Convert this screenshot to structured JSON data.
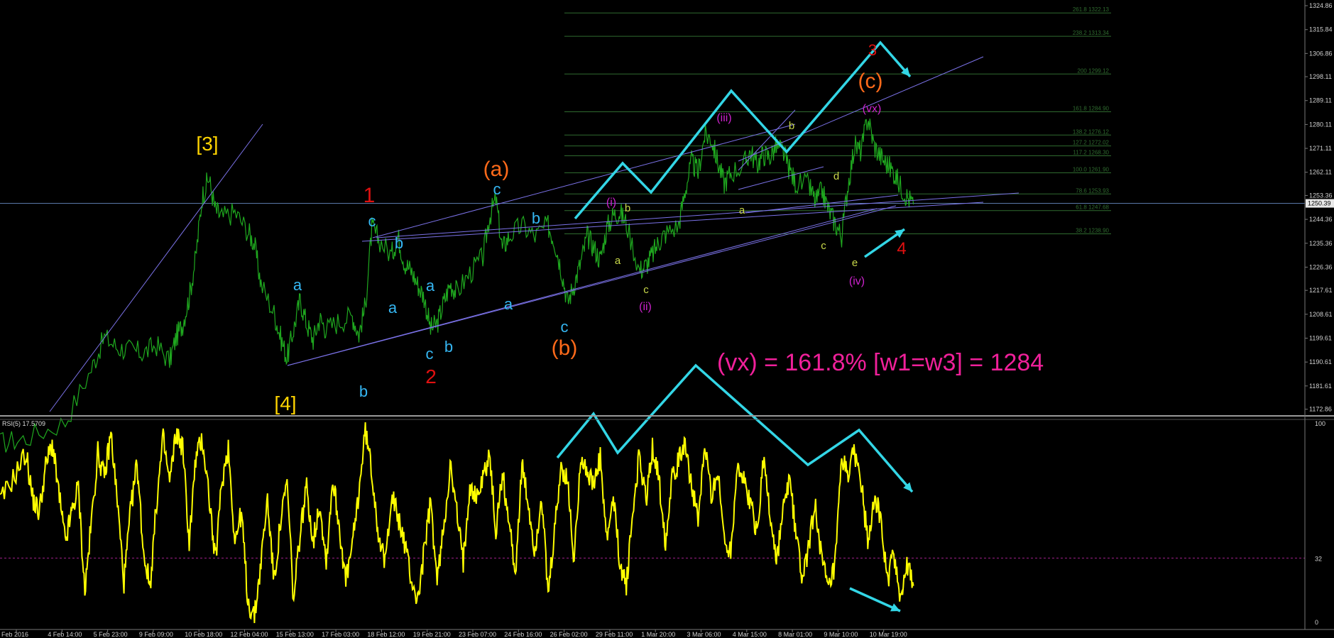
{
  "chart_data": {
    "type": "line",
    "price_axis": {
      "ticks": [
        "1324.86",
        "1315.84",
        "1306.86",
        "1298.11",
        "1289.11",
        "1280.11",
        "1271.11",
        "1262.11",
        "1253.36",
        "1244.36",
        "1235.36",
        "1226.36",
        "1217.61",
        "1208.61",
        "1199.61",
        "1190.61",
        "1181.61",
        "1172.86"
      ],
      "current_label": "1250.39",
      "current_price": 1250.39,
      "range": [
        1170.6,
        1327.0
      ]
    },
    "rsi": {
      "label": "RSI(5) 17.5709",
      "ticks": [
        "100",
        "32",
        "0"
      ],
      "level": 32,
      "range": [
        0,
        100
      ]
    },
    "time_axis": {
      "ticks": [
        "Feb 2016",
        "4 Feb 14:00",
        "5 Feb 23:00",
        "9 Feb 09:00",
        "10 Feb 18:00",
        "12 Feb 04:00",
        "15 Feb 13:00",
        "17 Feb 03:00",
        "18 Feb 12:00",
        "19 Feb 21:00",
        "23 Feb 07:00",
        "24 Feb 16:00",
        "26 Feb 02:00",
        "29 Feb 11:00",
        "1 Mar 20:00",
        "3 Mar 06:00",
        "4 Mar 15:00",
        "8 Mar 01:00",
        "9 Mar 10:00",
        "10 Mar 19:00"
      ]
    },
    "fib_levels": [
      {
        "label": "261.8  1322.13",
        "price": 1322.13
      },
      {
        "label": "238.2  1313.34",
        "price": 1313.34
      },
      {
        "label": "200  1299.12",
        "price": 1299.12
      },
      {
        "label": "161.8  1284.90",
        "price": 1284.9
      },
      {
        "label": "138.2  1276.12",
        "price": 1276.12
      },
      {
        "label": "127.2  1272.02",
        "price": 1272.02
      },
      {
        "label": "117.2  1268.30",
        "price": 1268.3
      },
      {
        "label": "100.0    1261.90",
        "price": 1261.9
      },
      {
        "label": "78.6  1253.93",
        "price": 1253.93
      },
      {
        "label": "61.8  1247.68",
        "price": 1247.68
      },
      {
        "label": "38.2  1238.90",
        "price": 1238.9
      }
    ],
    "price_series": [
      [
        0.0,
        1160
      ],
      [
        0.02,
        1162
      ],
      [
        0.05,
        1168
      ],
      [
        0.07,
        1188
      ],
      [
        0.08,
        1200
      ],
      [
        0.09,
        1196
      ],
      [
        0.1,
        1195
      ],
      [
        0.11,
        1194
      ],
      [
        0.12,
        1197
      ],
      [
        0.13,
        1191
      ],
      [
        0.135,
        1200
      ],
      [
        0.14,
        1205
      ],
      [
        0.145,
        1215
      ],
      [
        0.15,
        1230
      ],
      [
        0.155,
        1253
      ],
      [
        0.16,
        1260
      ],
      [
        0.165,
        1248
      ],
      [
        0.17,
        1245
      ],
      [
        0.18,
        1247
      ],
      [
        0.19,
        1240
      ],
      [
        0.195,
        1235
      ],
      [
        0.2,
        1220
      ],
      [
        0.21,
        1209
      ],
      [
        0.215,
        1200
      ],
      [
        0.22,
        1192
      ],
      [
        0.225,
        1203
      ],
      [
        0.23,
        1214
      ],
      [
        0.235,
        1205
      ],
      [
        0.24,
        1199
      ],
      [
        0.245,
        1207
      ],
      [
        0.25,
        1203
      ],
      [
        0.26,
        1206
      ],
      [
        0.27,
        1208
      ],
      [
        0.275,
        1201
      ],
      [
        0.28,
        1212
      ],
      [
        0.285,
        1241
      ],
      [
        0.29,
        1237
      ],
      [
        0.3,
        1231
      ],
      [
        0.305,
        1238
      ],
      [
        0.31,
        1228
      ],
      [
        0.315,
        1225
      ],
      [
        0.32,
        1220
      ],
      [
        0.325,
        1215
      ],
      [
        0.33,
        1203
      ],
      [
        0.335,
        1205
      ],
      [
        0.34,
        1213
      ],
      [
        0.345,
        1220
      ],
      [
        0.35,
        1217
      ],
      [
        0.36,
        1224
      ],
      [
        0.37,
        1230
      ],
      [
        0.375,
        1245
      ],
      [
        0.38,
        1252
      ],
      [
        0.385,
        1233
      ],
      [
        0.39,
        1238
      ],
      [
        0.4,
        1242
      ],
      [
        0.41,
        1238
      ],
      [
        0.42,
        1242
      ],
      [
        0.425,
        1236
      ],
      [
        0.43,
        1226
      ],
      [
        0.435,
        1213
      ],
      [
        0.44,
        1220
      ],
      [
        0.445,
        1228
      ],
      [
        0.45,
        1238
      ],
      [
        0.455,
        1234
      ],
      [
        0.46,
        1229
      ],
      [
        0.465,
        1241
      ],
      [
        0.47,
        1246
      ],
      [
        0.475,
        1247
      ],
      [
        0.48,
        1243
      ],
      [
        0.49,
        1225
      ],
      [
        0.495,
        1227
      ],
      [
        0.5,
        1231
      ],
      [
        0.505,
        1236
      ],
      [
        0.51,
        1239
      ],
      [
        0.52,
        1242
      ],
      [
        0.525,
        1255
      ],
      [
        0.53,
        1266
      ],
      [
        0.535,
        1262
      ],
      [
        0.54,
        1276
      ],
      [
        0.545,
        1275
      ],
      [
        0.55,
        1266
      ],
      [
        0.555,
        1258
      ],
      [
        0.56,
        1262
      ],
      [
        0.57,
        1265
      ],
      [
        0.575,
        1270
      ],
      [
        0.58,
        1265
      ],
      [
        0.585,
        1269
      ],
      [
        0.59,
        1268
      ],
      [
        0.595,
        1272
      ],
      [
        0.6,
        1270
      ],
      [
        0.605,
        1263
      ],
      [
        0.61,
        1258
      ],
      [
        0.62,
        1257
      ],
      [
        0.625,
        1251
      ],
      [
        0.63,
        1255
      ],
      [
        0.635,
        1248
      ],
      [
        0.64,
        1243
      ],
      [
        0.645,
        1238
      ],
      [
        0.65,
        1258
      ],
      [
        0.655,
        1272
      ],
      [
        0.66,
        1270
      ],
      [
        0.665,
        1283
      ],
      [
        0.67,
        1272
      ],
      [
        0.675,
        1268
      ],
      [
        0.68,
        1265
      ],
      [
        0.685,
        1262
      ],
      [
        0.69,
        1257
      ],
      [
        0.695,
        1253
      ],
      [
        0.7,
        1250
      ]
    ],
    "rsi_series": [
      [
        0.0,
        60
      ],
      [
        0.01,
        72
      ],
      [
        0.02,
        85
      ],
      [
        0.025,
        62
      ],
      [
        0.03,
        55
      ],
      [
        0.035,
        78
      ],
      [
        0.04,
        90
      ],
      [
        0.045,
        65
      ],
      [
        0.05,
        40
      ],
      [
        0.055,
        55
      ],
      [
        0.06,
        68
      ],
      [
        0.065,
        15
      ],
      [
        0.07,
        50
      ],
      [
        0.075,
        85
      ],
      [
        0.08,
        72
      ],
      [
        0.085,
        95
      ],
      [
        0.09,
        60
      ],
      [
        0.095,
        20
      ],
      [
        0.1,
        55
      ],
      [
        0.105,
        80
      ],
      [
        0.11,
        35
      ],
      [
        0.115,
        18
      ],
      [
        0.12,
        60
      ],
      [
        0.125,
        92
      ],
      [
        0.13,
        70
      ],
      [
        0.135,
        95
      ],
      [
        0.14,
        88
      ],
      [
        0.145,
        40
      ],
      [
        0.15,
        82
      ],
      [
        0.155,
        92
      ],
      [
        0.16,
        65
      ],
      [
        0.165,
        30
      ],
      [
        0.17,
        70
      ],
      [
        0.175,
        88
      ],
      [
        0.18,
        40
      ],
      [
        0.185,
        55
      ],
      [
        0.19,
        10
      ],
      [
        0.195,
        2
      ],
      [
        0.2,
        30
      ],
      [
        0.205,
        62
      ],
      [
        0.21,
        20
      ],
      [
        0.215,
        50
      ],
      [
        0.22,
        70
      ],
      [
        0.225,
        10
      ],
      [
        0.23,
        45
      ],
      [
        0.235,
        68
      ],
      [
        0.24,
        40
      ],
      [
        0.245,
        60
      ],
      [
        0.25,
        30
      ],
      [
        0.255,
        72
      ],
      [
        0.26,
        48
      ],
      [
        0.265,
        20
      ],
      [
        0.27,
        38
      ],
      [
        0.275,
        65
      ],
      [
        0.28,
        97
      ],
      [
        0.285,
        75
      ],
      [
        0.29,
        45
      ],
      [
        0.295,
        28
      ],
      [
        0.3,
        65
      ],
      [
        0.305,
        52
      ],
      [
        0.31,
        40
      ],
      [
        0.315,
        22
      ],
      [
        0.32,
        10
      ],
      [
        0.325,
        35
      ],
      [
        0.33,
        60
      ],
      [
        0.335,
        20
      ],
      [
        0.34,
        48
      ],
      [
        0.345,
        78
      ],
      [
        0.35,
        55
      ],
      [
        0.355,
        30
      ],
      [
        0.36,
        70
      ],
      [
        0.365,
        62
      ],
      [
        0.37,
        72
      ],
      [
        0.375,
        85
      ],
      [
        0.38,
        45
      ],
      [
        0.385,
        75
      ],
      [
        0.39,
        50
      ],
      [
        0.395,
        25
      ],
      [
        0.4,
        78
      ],
      [
        0.405,
        58
      ],
      [
        0.41,
        35
      ],
      [
        0.415,
        64
      ],
      [
        0.42,
        12
      ],
      [
        0.425,
        45
      ],
      [
        0.43,
        78
      ],
      [
        0.435,
        70
      ],
      [
        0.44,
        30
      ],
      [
        0.445,
        85
      ],
      [
        0.45,
        75
      ],
      [
        0.455,
        68
      ],
      [
        0.46,
        82
      ],
      [
        0.465,
        40
      ],
      [
        0.47,
        62
      ],
      [
        0.475,
        30
      ],
      [
        0.48,
        18
      ],
      [
        0.485,
        55
      ],
      [
        0.49,
        85
      ],
      [
        0.495,
        60
      ],
      [
        0.5,
        88
      ],
      [
        0.505,
        72
      ],
      [
        0.51,
        40
      ],
      [
        0.515,
        75
      ],
      [
        0.52,
        80
      ],
      [
        0.525,
        92
      ],
      [
        0.53,
        68
      ],
      [
        0.535,
        50
      ],
      [
        0.54,
        88
      ],
      [
        0.545,
        65
      ],
      [
        0.55,
        75
      ],
      [
        0.555,
        42
      ],
      [
        0.56,
        35
      ],
      [
        0.565,
        80
      ],
      [
        0.57,
        70
      ],
      [
        0.575,
        60
      ],
      [
        0.58,
        45
      ],
      [
        0.585,
        82
      ],
      [
        0.59,
        55
      ],
      [
        0.595,
        30
      ],
      [
        0.6,
        55
      ],
      [
        0.605,
        72
      ],
      [
        0.61,
        45
      ],
      [
        0.615,
        20
      ],
      [
        0.62,
        40
      ],
      [
        0.625,
        58
      ],
      [
        0.63,
        30
      ],
      [
        0.635,
        15
      ],
      [
        0.64,
        28
      ],
      [
        0.645,
        80
      ],
      [
        0.65,
        75
      ],
      [
        0.655,
        85
      ],
      [
        0.66,
        70
      ],
      [
        0.665,
        40
      ],
      [
        0.67,
        65
      ],
      [
        0.675,
        50
      ],
      [
        0.68,
        20
      ],
      [
        0.685,
        35
      ],
      [
        0.69,
        12
      ],
      [
        0.695,
        28
      ],
      [
        0.7,
        18
      ]
    ],
    "annotations": {
      "wave3": "[3]",
      "wave4": "[4]",
      "wave_a": "(a)",
      "wave_b": "(b)",
      "wave_c": "(c)",
      "red1": "1",
      "red2": "2",
      "red3": "3",
      "red4": "4",
      "i": "(i)",
      "ii": "(ii)",
      "iii": "(iii)",
      "iv": "(iv)",
      "vx": "(vx)",
      "a": "a",
      "b": "b",
      "c": "c",
      "d": "d",
      "e": "e",
      "note": "(vx) = 161.8% [w1=w3] = 1284"
    },
    "colors": {
      "background": "#000000",
      "price": "#1fa81f",
      "rsi": "#ffff00",
      "fib": "#2f6b2f",
      "channel": "#7b72e8",
      "arrow": "#33d6e6",
      "wave_yellow": "#ffd400",
      "wave_orange": "#ff6a1a",
      "wave_red": "#e01010",
      "wave_cyan": "#35b6f2",
      "wave_magenta": "#cc22cc",
      "wave_lime": "#c8d84a",
      "note": "#f0209a"
    }
  }
}
